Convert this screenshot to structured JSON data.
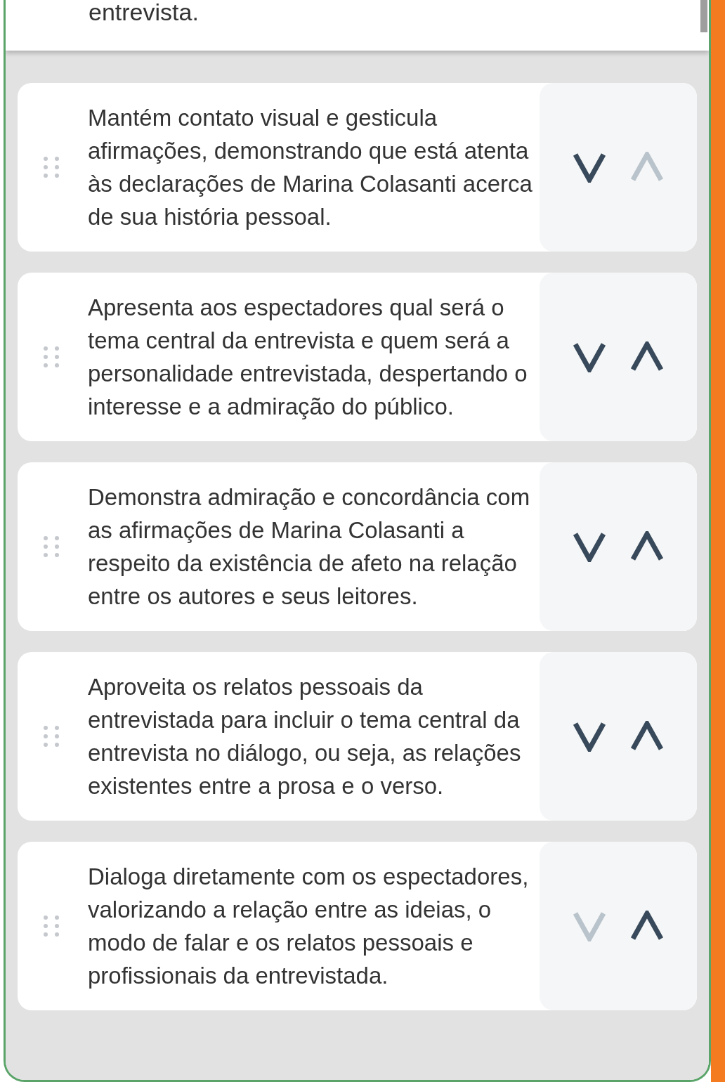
{
  "top_text": "entrevista.",
  "items": [
    {
      "text": "Mantém contato visual e gesticula afirmações, demonstrando que está atenta às declarações de Marina Colasanti acerca de sua história pessoal.",
      "up_disabled": true,
      "down_disabled": false
    },
    {
      "text": "Apresenta aos espectadores qual será o tema central da entrevista e quem será a personalidade entrevistada, despertando o interesse e a admiração do público.",
      "up_disabled": false,
      "down_disabled": false
    },
    {
      "text": "Demonstra admiração e concordância com as afirmações de Marina Colasanti a respeito da existência de afeto na relação entre os autores e seus leitores.",
      "up_disabled": false,
      "down_disabled": false
    },
    {
      "text": "Aproveita os relatos pessoais da entrevistada para incluir o tema central da entrevista no diálogo, ou seja, as relações existentes entre a prosa e o verso.",
      "up_disabled": false,
      "down_disabled": false
    },
    {
      "text": "Dialoga diretamente com os espectadores, valorizando a relação entre as ideias, o modo de falar e os relatos pessoais e profissionais da entrevistada.",
      "up_disabled": false,
      "down_disabled": true
    }
  ]
}
